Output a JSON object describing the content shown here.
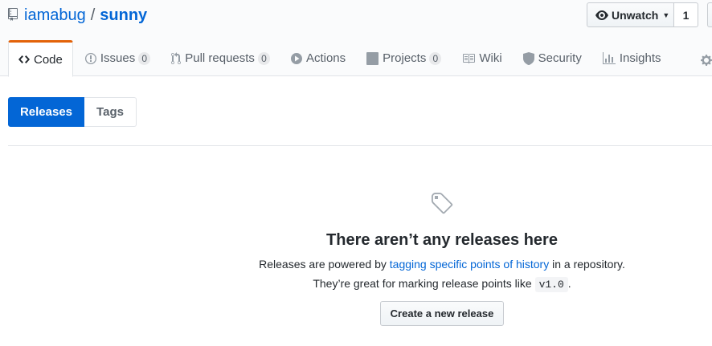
{
  "repo": {
    "owner": "iamabug",
    "separator": "/",
    "name": "sunny"
  },
  "watch": {
    "label": "Unwatch",
    "count": "1"
  },
  "nav": {
    "code": "Code",
    "issues": "Issues",
    "issues_count": "0",
    "pulls": "Pull requests",
    "pulls_count": "0",
    "actions": "Actions",
    "projects": "Projects",
    "projects_count": "0",
    "wiki": "Wiki",
    "security": "Security",
    "insights": "Insights"
  },
  "subnav": {
    "releases": "Releases",
    "tags": "Tags"
  },
  "blankslate": {
    "title": "There aren’t any releases here",
    "line1_pre": "Releases are powered by ",
    "line1_link": "tagging specific points of history",
    "line1_post": " in a repository.",
    "line2_pre": "They’re great for marking release points like ",
    "line2_code": "v1.0",
    "line2_post": ".",
    "button": "Create a new release"
  },
  "colors": {
    "accent": "#0366d6",
    "tab_underline": "#e36209"
  }
}
